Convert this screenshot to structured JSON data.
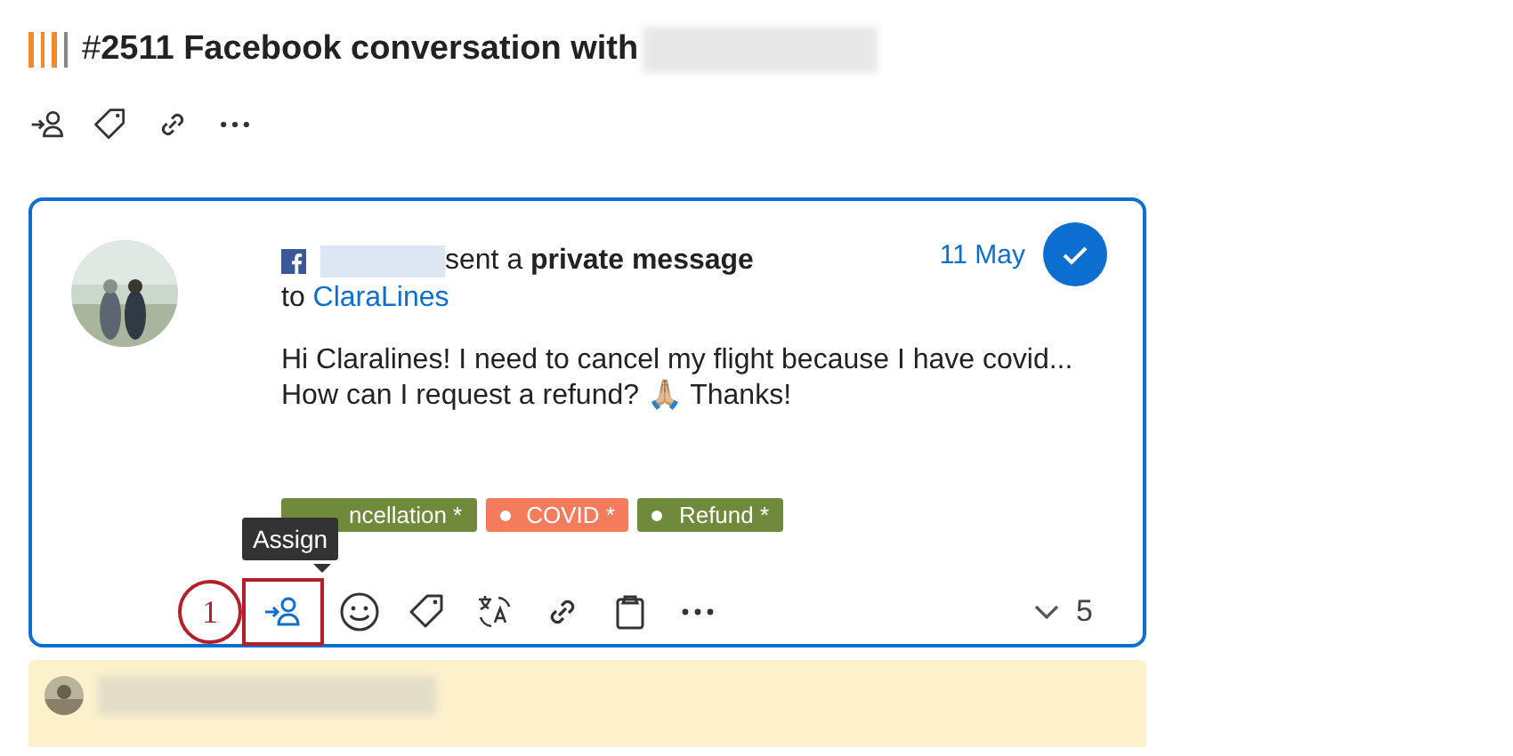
{
  "header": {
    "priority": {
      "level": 0.75
    },
    "hash": "#",
    "number": "2511",
    "title": "Facebook conversation with"
  },
  "header_actions": [
    {
      "kind": "assign"
    },
    {
      "kind": "tag"
    },
    {
      "kind": "link"
    },
    {
      "kind": "more"
    }
  ],
  "message": {
    "verb": "sent a",
    "action": "private message",
    "to_label": "to",
    "recipient": "ClaraLines",
    "date": "11 May",
    "resolved": true,
    "body": [
      "Hi Claralines! I need to cancel my flight because I have covid...",
      "How can I request a refund? 🙏🏼 Thanks!"
    ],
    "tags": [
      {
        "label": "ncellation *",
        "color": "#6f8a3a",
        "dot": false
      },
      {
        "label": "COVID *",
        "color": "#f47c5c",
        "dot": true
      },
      {
        "label": "Refund *",
        "color": "#6f8a3a",
        "dot": true
      }
    ],
    "actions": [
      {
        "kind": "assign",
        "highlighted": true
      },
      {
        "kind": "emoji",
        "highlighted": false
      },
      {
        "kind": "tag",
        "highlighted": false
      },
      {
        "kind": "translate",
        "highlighted": false
      },
      {
        "kind": "link",
        "highlighted": false
      },
      {
        "kind": "clipboard",
        "highlighted": false
      },
      {
        "kind": "more",
        "highlighted": false
      }
    ],
    "reply_count": "5",
    "tooltip": "Assign",
    "step_marker": "1"
  }
}
